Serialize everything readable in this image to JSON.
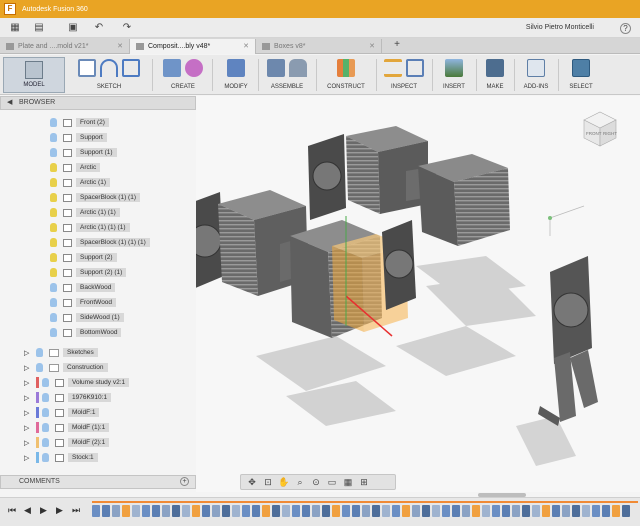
{
  "app": {
    "title": "Autodesk Fusion 360"
  },
  "user": {
    "name": "Silvio Pietro Monticelli",
    "help": "?"
  },
  "tabs": [
    {
      "label": "Plate and ....mold v21*"
    },
    {
      "label": "Composit....bly v48*"
    },
    {
      "label": "Boxes v8*"
    }
  ],
  "ribbon": {
    "mode": "MODEL",
    "groups": [
      {
        "label": "SKETCH"
      },
      {
        "label": "CREATE"
      },
      {
        "label": "MODIFY"
      },
      {
        "label": "ASSEMBLE"
      },
      {
        "label": "CONSTRUCT"
      },
      {
        "label": "INSPECT"
      },
      {
        "label": "INSERT"
      },
      {
        "label": "MAKE"
      },
      {
        "label": "ADD-INS"
      },
      {
        "label": "SELECT"
      }
    ]
  },
  "browser": {
    "title": "BROWSER",
    "items": [
      {
        "label": "Front (2)"
      },
      {
        "label": "Support"
      },
      {
        "label": "Support (1)"
      },
      {
        "label": "Arctic"
      },
      {
        "label": "Arctic (1)"
      },
      {
        "label": "SpacerBlock (1) (1)"
      },
      {
        "label": "Arctic (1) (1)"
      },
      {
        "label": "Arctic (1) (1) (1)"
      },
      {
        "label": "SpacerBlock (1) (1) (1)"
      },
      {
        "label": "Support (2)"
      },
      {
        "label": "Support (2) (1)"
      },
      {
        "label": "BackWood"
      },
      {
        "label": "FrontWood"
      },
      {
        "label": "SideWood (1)"
      },
      {
        "label": "BottomWood"
      }
    ],
    "folders": [
      {
        "label": "Sketches"
      },
      {
        "label": "Construction"
      }
    ],
    "components": [
      {
        "label": "Volume study v2:1",
        "color": "#e06060"
      },
      {
        "label": "1976K910:1",
        "color": "#9b7ad8"
      },
      {
        "label": "MoldF:1",
        "color": "#6a7ad8"
      },
      {
        "label": "MoldF (1):1",
        "color": "#e06a9a"
      },
      {
        "label": "MoldF (2):1",
        "color": "#f0c070"
      },
      {
        "label": "Stock:1",
        "color": "#7ab8e8"
      }
    ]
  },
  "comments": {
    "title": "COMMENTS"
  },
  "viewcube": {
    "face_front": "FRONT",
    "face_right": "RIGHT"
  },
  "colors": {
    "accent": "#e9a424",
    "timeline": "#f08a35"
  }
}
